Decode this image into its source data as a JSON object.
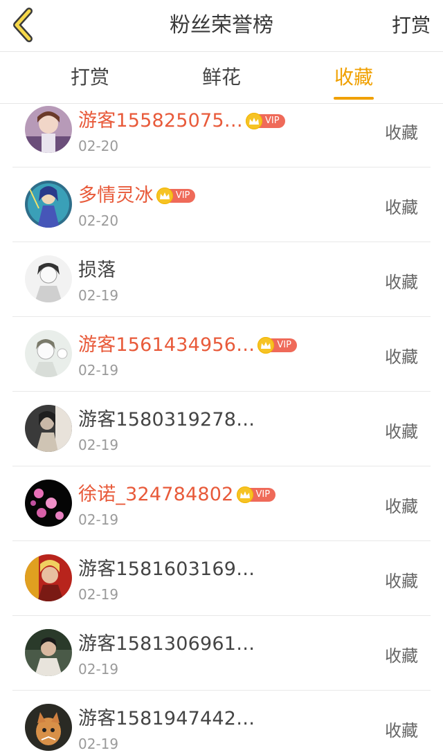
{
  "header": {
    "title": "粉丝荣誉榜",
    "action_label": "打赏"
  },
  "tabs": [
    {
      "label": "打赏"
    },
    {
      "label": "鲜花"
    },
    {
      "label": "收藏",
      "active": true
    }
  ],
  "colors": {
    "accent": "#f0a000",
    "vip_name": "#e85a3a",
    "vip_tag": "#ef6a59",
    "crown": "#f6c324"
  },
  "vip_label": "VIP",
  "rows": [
    {
      "name": "游客155825075…",
      "vip": true,
      "date": "02-20",
      "action": "收藏"
    },
    {
      "name": "多情灵冰",
      "vip": true,
      "date": "02-20",
      "action": "收藏"
    },
    {
      "name": "损落",
      "vip": false,
      "date": "02-19",
      "action": "收藏"
    },
    {
      "name": "游客1561434956…",
      "vip": true,
      "date": "02-19",
      "action": "收藏"
    },
    {
      "name": "游客1580319278…",
      "vip": false,
      "date": "02-19",
      "action": "收藏"
    },
    {
      "name": "徐诺_324784802",
      "vip": true,
      "date": "02-19",
      "action": "收藏"
    },
    {
      "name": "游客1581603169…",
      "vip": false,
      "date": "02-19",
      "action": "收藏"
    },
    {
      "name": "游客1581306961…",
      "vip": false,
      "date": "02-19",
      "action": "收藏"
    },
    {
      "name": "游客1581947442…",
      "vip": false,
      "date": "02-19",
      "action": "收藏"
    }
  ]
}
